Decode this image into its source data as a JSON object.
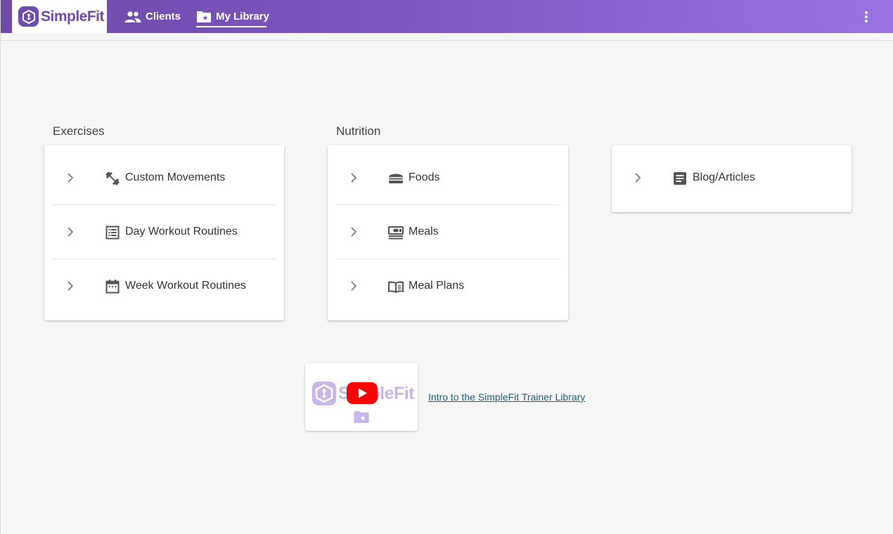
{
  "app": {
    "logo_text": "SimpleFit"
  },
  "nav": {
    "clients_label": "Clients",
    "library_label": "My Library"
  },
  "sections": {
    "exercises_title": "Exercises",
    "nutrition_title": "Nutrition"
  },
  "exercises": [
    {
      "label": "Custom Movements",
      "icon": "dumbbell-icon"
    },
    {
      "label": "Day Workout Routines",
      "icon": "list-icon"
    },
    {
      "label": "Week Workout Routines",
      "icon": "calendar-icon"
    }
  ],
  "nutrition": [
    {
      "label": "Foods",
      "icon": "burger-icon"
    },
    {
      "label": "Meals",
      "icon": "meal-icon"
    },
    {
      "label": "Meal Plans",
      "icon": "book-icon"
    }
  ],
  "other": [
    {
      "label": "Blog/Articles",
      "icon": "article-icon"
    }
  ],
  "video": {
    "thumb_text": "SimpleFit",
    "link_text": "Intro to the SimpleFit Trainer Library"
  },
  "colors": {
    "brand": "#6f4cb0",
    "topbar_start": "#6d4aa8",
    "topbar_end": "#9a73e2",
    "link": "#1f5e7a",
    "youtube_red": "#ff0000"
  }
}
